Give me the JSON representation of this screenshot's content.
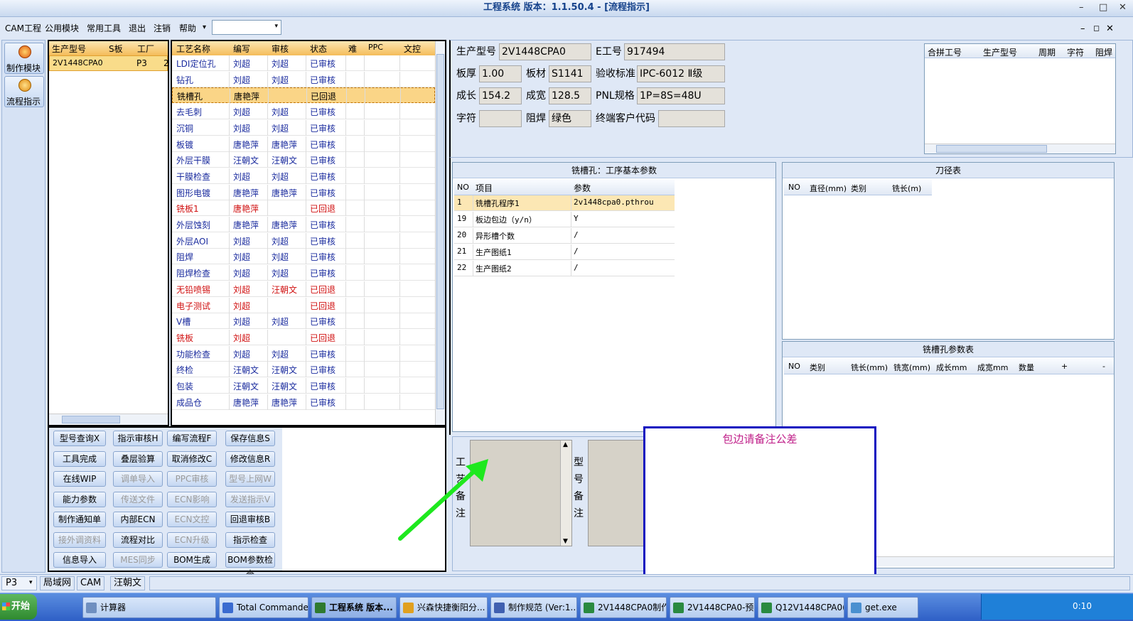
{
  "window": {
    "title": "工程系统  版本：1.1.50.4 - [流程指示]",
    "min": "–",
    "max": "□",
    "close": "✕"
  },
  "menu": {
    "items": [
      "CAM工程",
      "公用模块",
      "常用工具",
      "退出",
      "注销",
      "帮助"
    ],
    "arrow": "▾",
    "mdi_min": "–",
    "mdi_restore": "◻",
    "mdi_close": "✕"
  },
  "side": {
    "make": "制作模块",
    "flow": "流程指示"
  },
  "model_list": {
    "headers": [
      "生产型号",
      "S板",
      "工厂"
    ],
    "rows": [
      [
        "2V1448CPA0",
        "",
        "P3"
      ]
    ],
    "extra": "2"
  },
  "proc": {
    "headers": [
      "工艺名称",
      "编写",
      "审核",
      "状态",
      "难",
      "PPC",
      "文控"
    ],
    "rows": [
      {
        "name": "LDI定位孔",
        "w": "刘超",
        "a": "刘超",
        "s": "已审核",
        "c": "n"
      },
      {
        "name": "钻孔",
        "w": "刘超",
        "a": "刘超",
        "s": "已审核",
        "c": "n"
      },
      {
        "name": "铣槽孔",
        "w": "唐艳萍",
        "a": "",
        "s": "已回退",
        "c": "sel"
      },
      {
        "name": "去毛刺",
        "w": "刘超",
        "a": "刘超",
        "s": "已审核",
        "c": "n"
      },
      {
        "name": "沉铜",
        "w": "刘超",
        "a": "刘超",
        "s": "已审核",
        "c": "n"
      },
      {
        "name": "板镀",
        "w": "唐艳萍",
        "a": "唐艳萍",
        "s": "已审核",
        "c": "n"
      },
      {
        "name": "外层干膜",
        "w": "汪朝文",
        "a": "汪朝文",
        "s": "已审核",
        "c": "n"
      },
      {
        "name": "干膜检查",
        "w": "刘超",
        "a": "刘超",
        "s": "已审核",
        "c": "n"
      },
      {
        "name": "图形电镀",
        "w": "唐艳萍",
        "a": "唐艳萍",
        "s": "已审核",
        "c": "n"
      },
      {
        "name": "铣板1",
        "w": "唐艳萍",
        "a": "",
        "s": "已回退",
        "c": "r"
      },
      {
        "name": "外层蚀刻",
        "w": "唐艳萍",
        "a": "唐艳萍",
        "s": "已审核",
        "c": "n"
      },
      {
        "name": "外层AOI",
        "w": "刘超",
        "a": "刘超",
        "s": "已审核",
        "c": "n"
      },
      {
        "name": "阻焊",
        "w": "刘超",
        "a": "刘超",
        "s": "已审核",
        "c": "n"
      },
      {
        "name": "阻焊检查",
        "w": "刘超",
        "a": "刘超",
        "s": "已审核",
        "c": "n"
      },
      {
        "name": "无铅喷锡",
        "w": "刘超",
        "a": "汪朝文",
        "s": "已回退",
        "c": "r"
      },
      {
        "name": "电子测试",
        "w": "刘超",
        "a": "",
        "s": "已回退",
        "c": "r"
      },
      {
        "name": "V槽",
        "w": "刘超",
        "a": "刘超",
        "s": "已审核",
        "c": "n"
      },
      {
        "name": "铣板",
        "w": "刘超",
        "a": "",
        "s": "已回退",
        "c": "r"
      },
      {
        "name": "功能检查",
        "w": "刘超",
        "a": "刘超",
        "s": "已审核",
        "c": "n"
      },
      {
        "name": "终检",
        "w": "汪朝文",
        "a": "汪朝文",
        "s": "已审核",
        "c": "n"
      },
      {
        "name": "包装",
        "w": "汪朝文",
        "a": "汪朝文",
        "s": "已审核",
        "c": "n"
      },
      {
        "name": "成品仓",
        "w": "唐艳萍",
        "a": "唐艳萍",
        "s": "已审核",
        "c": "n"
      }
    ]
  },
  "buttons": [
    [
      {
        "t": "型号查询X",
        "d": false
      },
      {
        "t": "指示审核H",
        "d": false
      },
      {
        "t": "编写流程F",
        "d": false
      },
      {
        "t": "保存信息S",
        "d": false
      }
    ],
    [
      {
        "t": "工具完成",
        "d": false
      },
      {
        "t": "叠层验算",
        "d": false
      },
      {
        "t": "取消修改C",
        "d": false
      },
      {
        "t": "修改信息R",
        "d": false
      }
    ],
    [
      {
        "t": "在线WIP",
        "d": false
      },
      {
        "t": "调单导入",
        "d": true
      },
      {
        "t": "PPC审核",
        "d": true
      },
      {
        "t": "型号上网W",
        "d": true
      }
    ],
    [
      {
        "t": "能力参数",
        "d": false
      },
      {
        "t": "传送文件",
        "d": true
      },
      {
        "t": "ECN影响",
        "d": true
      },
      {
        "t": "发送指示V",
        "d": true
      }
    ],
    [
      {
        "t": "制作通知单",
        "d": false
      },
      {
        "t": "内部ECN",
        "d": false
      },
      {
        "t": "ECN文控",
        "d": true
      },
      {
        "t": "回退审核B",
        "d": false
      }
    ],
    [
      {
        "t": "接外调资料",
        "d": true
      },
      {
        "t": "流程对比",
        "d": false
      },
      {
        "t": "ECN升级",
        "d": true
      },
      {
        "t": "指示检查",
        "d": false
      }
    ],
    [
      {
        "t": "信息导入",
        "d": false
      },
      {
        "t": "MES同步",
        "d": true
      },
      {
        "t": "BOM生成",
        "d": false
      },
      {
        "t": "BOM参数检查",
        "d": false
      }
    ]
  ],
  "info": {
    "model_l": "生产型号",
    "model_v": "2V1448CPA0",
    "e_l": "E工号",
    "e_v": "917494",
    "thick_l": "板厚",
    "thick_v": "1.00",
    "mat_l": "板材",
    "mat_v": "S1141",
    "std_l": "验收标准",
    "std_v": "IPC-6012 Ⅱ级",
    "len_l": "成长",
    "len_v": "154.2",
    "wid_l": "成宽",
    "wid_v": "128.5",
    "pnl_l": "PNL规格",
    "pnl_v": "1P=8S=48U",
    "char_l": "字符",
    "char_v": "",
    "mask_l": "阻焊",
    "mask_v": "绿色",
    "cust_l": "终端客户代码",
    "cust_v": ""
  },
  "combine": {
    "headers": [
      "合拼工号",
      "生产型号",
      "周期",
      "字符",
      "阻焊"
    ]
  },
  "params": {
    "title": "铣槽孔：工序基本参数",
    "headers": [
      "NO",
      "项目",
      "参数"
    ],
    "rows": [
      [
        "1",
        "铣槽孔程序1",
        "2v1448cpa0.pthrou"
      ],
      [
        "19",
        "板边包边（y/n）",
        "Y"
      ],
      [
        "20",
        "异形槽个数",
        "/"
      ],
      [
        "21",
        "生产图纸1",
        "/"
      ],
      [
        "22",
        "生产图纸2",
        "/"
      ]
    ]
  },
  "tools": {
    "title": "刀径表",
    "headers": [
      "NO",
      "直径(mm)",
      "类别",
      "铣长(m)"
    ]
  },
  "slot": {
    "title": "铣槽孔参数表",
    "headers": [
      "NO",
      "类别",
      "铣长(mm)",
      "铣宽(mm)",
      "成长mm",
      "成宽mm",
      "数量",
      "+",
      "-"
    ]
  },
  "notes": {
    "proc_label": "工艺备注",
    "model_label": "型号备注",
    "up": "▲",
    "down": "▼"
  },
  "popup": {
    "text": "包边请备注公差"
  },
  "status": {
    "factory": "P3",
    "arrow": "▾",
    "tabs": [
      "局域网",
      "CAM",
      "汪朝文"
    ]
  },
  "taskbar": {
    "start": "开始",
    "items": [
      "计算器",
      "Total Commander ...",
      "工程系统  版本...",
      "兴森快捷衡阳分...",
      "制作规范 (Ver:1....",
      "2V1448CPA0制作...",
      "2V1448CPA0-预...",
      "Q12V1448CPA0(h...",
      "get.exe"
    ],
    "clock": "0:10"
  }
}
